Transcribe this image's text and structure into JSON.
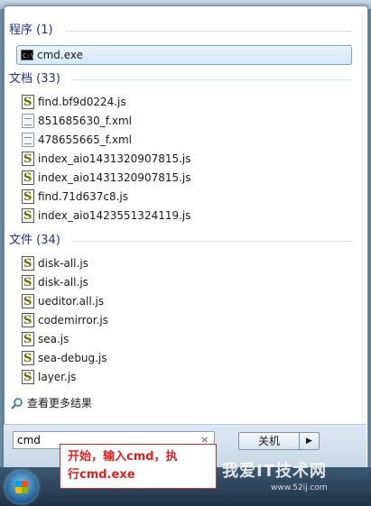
{
  "groups": [
    {
      "header": "程序 (1)",
      "items": [
        {
          "label": "cmd.exe",
          "icon": "cmd"
        }
      ]
    },
    {
      "header": "文档 (33)",
      "items": [
        {
          "label": "find.bf9d0224.js",
          "icon": "js"
        },
        {
          "label": "851685630_f.xml",
          "icon": "xml"
        },
        {
          "label": "478655665_f.xml",
          "icon": "xml"
        },
        {
          "label": "index_aio1431320907815.js",
          "icon": "js"
        },
        {
          "label": "index_aio1431320907815.js",
          "icon": "js"
        },
        {
          "label": "find.71d637c8.js",
          "icon": "js"
        },
        {
          "label": "index_aio1423551324119.js",
          "icon": "js"
        }
      ]
    },
    {
      "header": "文件 (34)",
      "items": [
        {
          "label": "disk-all.js",
          "icon": "js"
        },
        {
          "label": "disk-all.js",
          "icon": "js"
        },
        {
          "label": "ueditor.all.js",
          "icon": "js"
        },
        {
          "label": "codemirror.js",
          "icon": "js"
        },
        {
          "label": "sea.js",
          "icon": "js"
        },
        {
          "label": "sea-debug.js",
          "icon": "js"
        },
        {
          "label": "layer.js",
          "icon": "js"
        }
      ]
    }
  ],
  "see_more": "查看更多结果",
  "search": {
    "value": "cmd",
    "clear": "×"
  },
  "shutdown": {
    "label": "关机",
    "arrow": "▶"
  },
  "callout": {
    "line1": "开始，输入cmd，执",
    "line2": "行cmd.exe"
  },
  "watermark": {
    "main": "我爱IT技术网",
    "sub": "www.52ij.com"
  }
}
